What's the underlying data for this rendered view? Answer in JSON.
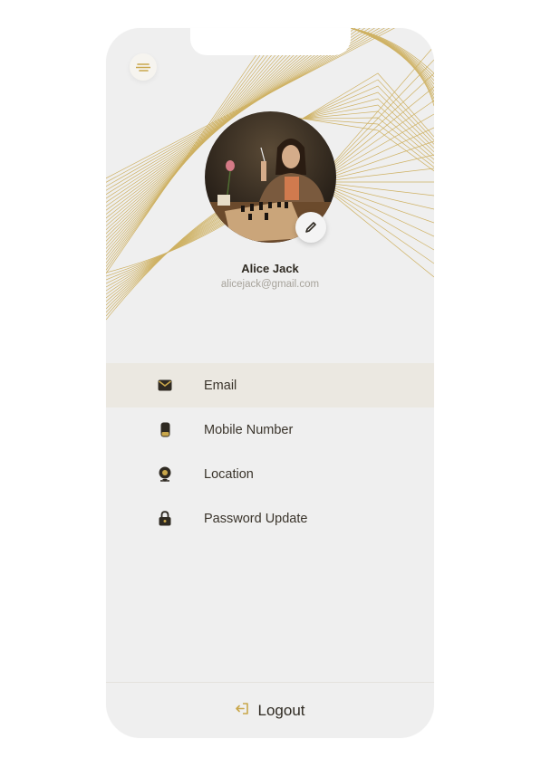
{
  "profile": {
    "name": "Alice Jack",
    "email": "alicejack@gmail.com"
  },
  "menu": {
    "items": [
      {
        "label": "Email",
        "icon": "envelope-icon",
        "active": true
      },
      {
        "label": "Mobile Number",
        "icon": "mobile-phone-icon",
        "active": false
      },
      {
        "label": "Location",
        "icon": "location-pin-icon",
        "active": false
      },
      {
        "label": "Password Update",
        "icon": "lock-icon",
        "active": false
      }
    ]
  },
  "logout": {
    "label": "Logout",
    "icon": "logout-icon"
  },
  "colors": {
    "accent": "#c9a74b",
    "background": "#efefef",
    "active_row": "#ebe8e1",
    "text": "#3a342b",
    "muted": "#a7a39b"
  }
}
